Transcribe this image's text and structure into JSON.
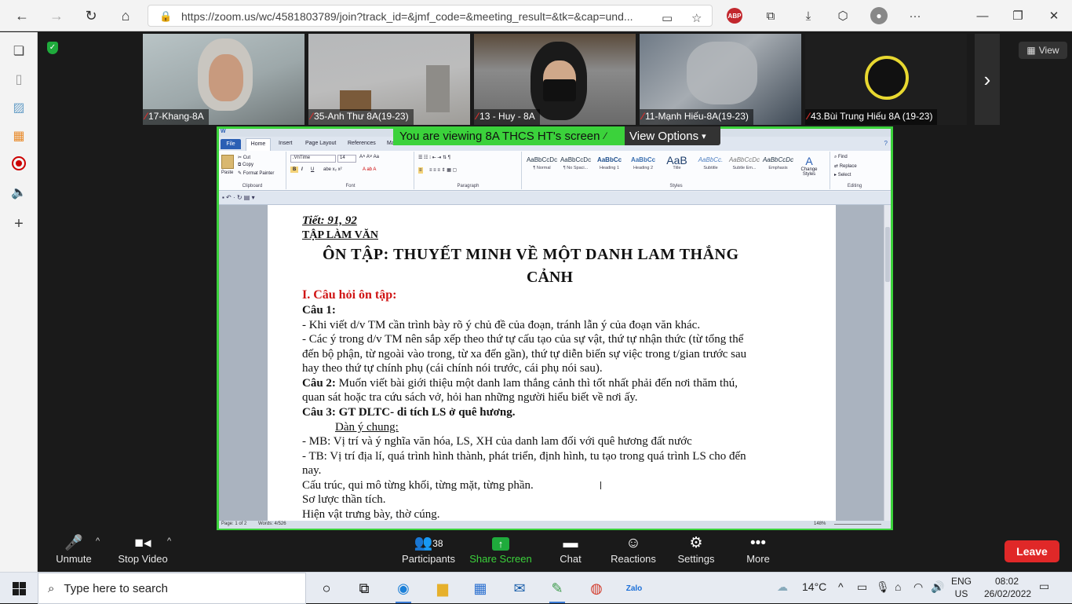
{
  "browser": {
    "url": "https://zoom.us/wc/4581803789/join?track_id=&jmf_code=&meeting_result=&tk=&cap=und..."
  },
  "zoom": {
    "participants_tiles": [
      {
        "name": "17-Khang-8A"
      },
      {
        "name": "35-Anh Thư 8A(19-23)"
      },
      {
        "name": "13 - Huy - 8A"
      },
      {
        "name": "11-Mạnh Hiếu-8A(19-23)"
      },
      {
        "name": "43.Bùi Trung Hiếu 8A (19-23)"
      }
    ],
    "view_label": "View",
    "share_banner": "You are viewing 8A THCS HT's screen",
    "view_options": "View Options",
    "toolbar": {
      "unmute": "Unmute",
      "stop_video": "Stop Video",
      "participants": "Participants",
      "participants_count": "38",
      "share_screen": "Share Screen",
      "chat": "Chat",
      "reactions": "Reactions",
      "settings": "Settings",
      "more": "More",
      "leave": "Leave"
    }
  },
  "word": {
    "tabs": [
      "File",
      "Home",
      "Insert",
      "Page Layout",
      "References",
      "Ma"
    ],
    "clipboard": {
      "paste": "Paste",
      "cut": "Cut",
      "copy": "Copy",
      "format_painter": "Format Painter",
      "label": "Clipboard"
    },
    "font": {
      "name": ".VnTime",
      "size": "14",
      "label": "Font"
    },
    "paragraph_label": "Paragraph",
    "styles": [
      {
        "preview": "AaBbCcDc",
        "name": "¶ Normal"
      },
      {
        "preview": "AaBbCcDc",
        "name": "¶ No Spaci..."
      },
      {
        "preview": "AaBbCc",
        "name": "Heading 1"
      },
      {
        "preview": "AaBbCc",
        "name": "Heading 2"
      },
      {
        "preview": "AaB",
        "name": "Title"
      },
      {
        "preview": "AaBbCc.",
        "name": "Subtitle"
      },
      {
        "preview": "AaBbCcDc",
        "name": "Subtle Em..."
      },
      {
        "preview": "AaBbCcDc",
        "name": "Emphasis"
      }
    ],
    "styles_label": "Styles",
    "change_styles": "Change Styles",
    "editing": {
      "find": "Find",
      "replace": "Replace",
      "select": "Select",
      "label": "Editing"
    },
    "status": {
      "page": "Page: 1 of 2",
      "words": "Words: 4/526",
      "zoom": "148%"
    },
    "doc": {
      "l1": "Tiết: 91, 92",
      "l2": "TẬP LÀM VĂN",
      "l3": "ÔN TẬP: THUYẾT MINH VỀ MỘT DANH LAM THẮNG",
      "l4": "CẢNH",
      "l5": "I. Câu hỏi ôn tập:",
      "l6": "Câu 1:",
      "l7": "- Khi viết d/v TM cần trình bày rõ ý chủ đề của đoạn, tránh lẫn ý của đoạn văn khác.",
      "l8": "- Các ý trong d/v TM nên sắp xếp theo thứ tự cấu tạo của sự vật, thứ tự nhận thức (từ tổng thể",
      "l9": "đến bộ phận, từ ngoài vào trong, từ xa đến gần), thứ tự diễn biến sự việc trong t/gian trước sau",
      "l10": "hay theo thứ tự chính phụ (cái chính nói trước, cái phụ nói sau).",
      "l11a": "Câu 2:",
      "l11b": " Muốn viết bài giới thiệu một danh lam thắng cảnh thì tốt nhất phải đến nơi thăm thú,",
      "l12": "quan sát hoặc tra cứu sách vở, hỏi han những người hiểu biết về nơi ấy.",
      "l13": "Câu 3: GT DLTC- di tích LS ở quê hương.",
      "l14": "Dàn ý chung:",
      "l15": "- MB: Vị trí và ý nghĩa văn hóa, LS, XH của danh lam đối với quê hương đất nước",
      "l16": "- TB: Vị trí địa lí, quá trình hình thành, phát triển, định hình, tu tạo trong quá trình LS cho đến",
      "l17": "nay.",
      "l18": "Cấu trúc, qui mô từng khối, từng mặt, từng phần.",
      "l19": "Sơ lược thần tích.",
      "l20": "Hiện vật trưng bày, thờ cúng."
    }
  },
  "taskbar": {
    "search_placeholder": "Type here to search",
    "weather": "14°C",
    "lang_1": "ENG",
    "lang_2": "US",
    "time": "08:02",
    "date": "26/02/2022"
  }
}
